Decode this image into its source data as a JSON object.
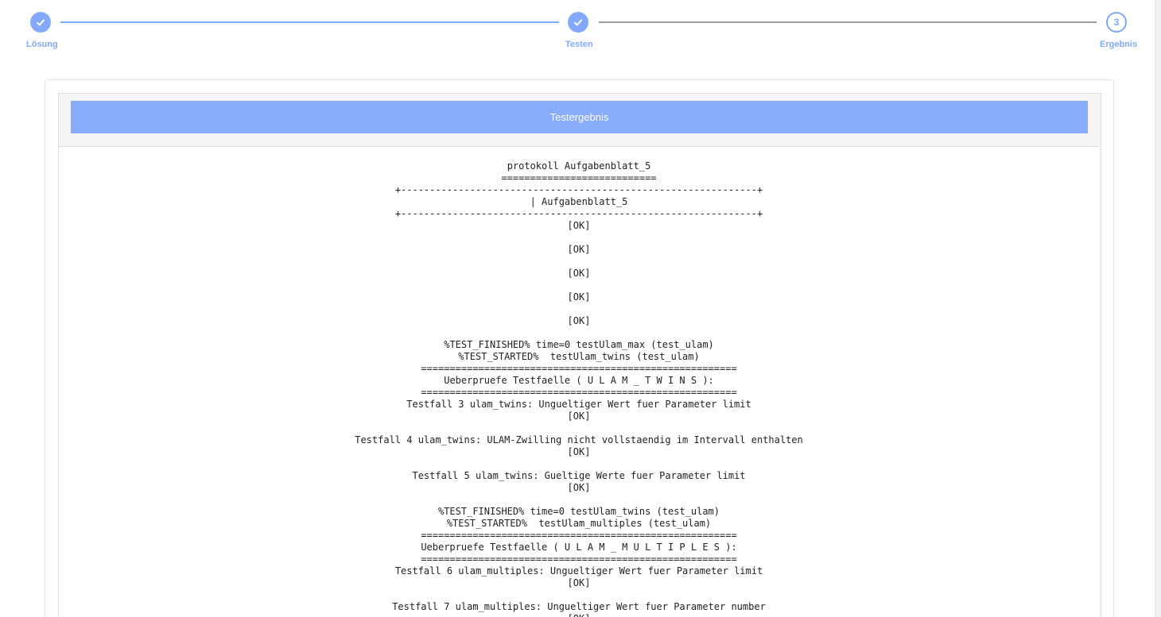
{
  "stepper": {
    "steps": [
      {
        "label": "Lösung",
        "state": "done"
      },
      {
        "label": "Testen",
        "state": "done"
      },
      {
        "label": "Ergebnis",
        "state": "current",
        "number": "3"
      }
    ],
    "icons": {
      "completed": "check-icon"
    },
    "colors": {
      "accent": "#82a9fb",
      "inactive_line": "#9e9e9e"
    }
  },
  "result": {
    "title": "Testergebnis",
    "header_color": "#89abfc",
    "log_lines": [
      "protokoll Aufgabenblatt_5",
      "===========================",
      "+--------------------------------------------------------------+",
      "| Aufgabenblatt_5",
      "+--------------------------------------------------------------+",
      "[OK]",
      "",
      "[OK]",
      "",
      "[OK]",
      "",
      "[OK]",
      "",
      "[OK]",
      "",
      "%TEST_FINISHED% time=0 testUlam_max (test_ulam)",
      "%TEST_STARTED%  testUlam_twins (test_ulam)",
      "=======================================================",
      "Ueberpruefe Testfaelle ( U L A M _ T W I N S ):",
      "=======================================================",
      "Testfall 3 ulam_twins: Ungueltiger Wert fuer Parameter limit",
      "[OK]",
      "",
      "Testfall 4 ulam_twins: ULAM-Zwilling nicht vollstaendig im Intervall enthalten",
      "[OK]",
      "",
      "Testfall 5 ulam_twins: Gueltige Werte fuer Parameter limit",
      "[OK]",
      "",
      "%TEST_FINISHED% time=0 testUlam_twins (test_ulam)",
      "%TEST_STARTED%  testUlam_multiples (test_ulam)",
      "=======================================================",
      "Ueberpruefe Testfaelle ( U L A M _ M U L T I P L E S ):",
      "=======================================================",
      "Testfall 6 ulam_multiples: Ungueltiger Wert fuer Parameter limit",
      "[OK]",
      "",
      "Testfall 7 ulam_multiples: Ungueltiger Wert fuer Parameter number",
      "[OK]"
    ]
  }
}
